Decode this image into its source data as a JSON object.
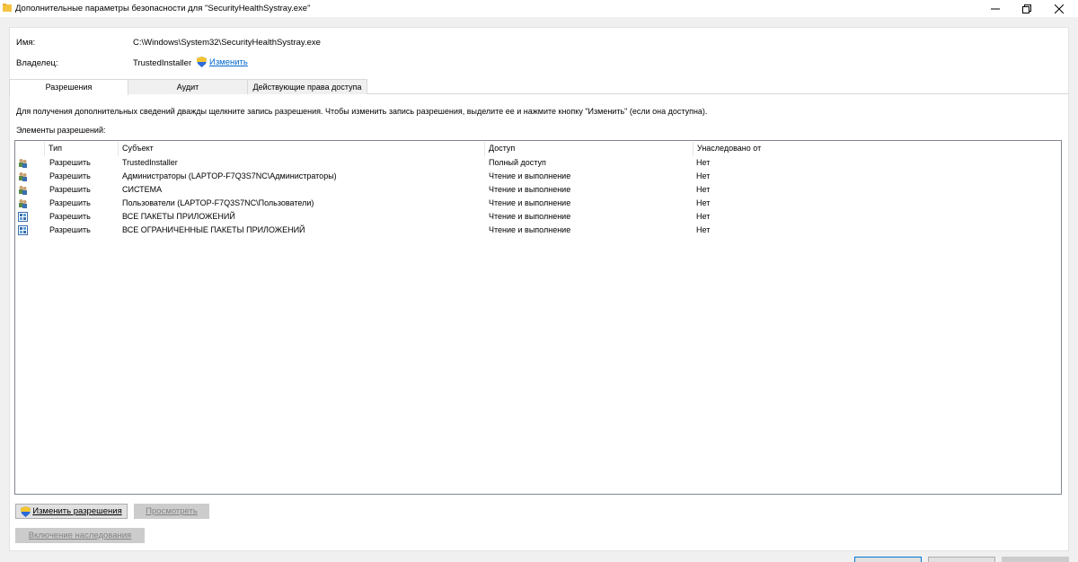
{
  "window": {
    "title": "Дополнительные параметры безопасности  для \"SecurityHealthSystray.exe\"",
    "buttons": {
      "minimize": "—",
      "maximize": "▢",
      "close": "✕"
    }
  },
  "fields": {
    "name_label": "Имя:",
    "name_value": "C:\\Windows\\System32\\SecurityHealthSystray.exe",
    "owner_label": "Владелец:",
    "owner_value": "TrustedInstaller",
    "owner_change_link": "Изменить"
  },
  "tabs": [
    {
      "label": "Разрешения",
      "active": true
    },
    {
      "label": "Аудит",
      "active": false
    },
    {
      "label": "Действующие права доступа",
      "active": false
    }
  ],
  "info_text": "Для получения дополнительных сведений дважды щелкните запись разрешения. Чтобы изменить запись разрешения, выделите ее и нажмите кнопку \"Изменить\" (если она доступна).",
  "elements_label": "Элементы разрешений:",
  "table": {
    "columns": [
      "Тип",
      "Субъект",
      "Доступ",
      "Унаследовано от"
    ],
    "rows": [
      {
        "icon": "users-icon",
        "type": "Разрешить",
        "subject": "TrustedInstaller",
        "access": "Полный доступ",
        "inherited": "Нет"
      },
      {
        "icon": "users-icon",
        "type": "Разрешить",
        "subject": "Администраторы (LAPTOP-F7Q3S7NC\\Администраторы)",
        "access": "Чтение и выполнение",
        "inherited": "Нет"
      },
      {
        "icon": "users-icon",
        "type": "Разрешить",
        "subject": "СИСТЕМА",
        "access": "Чтение и выполнение",
        "inherited": "Нет"
      },
      {
        "icon": "users-icon",
        "type": "Разрешить",
        "subject": "Пользователи (LAPTOP-F7Q3S7NC\\Пользователи)",
        "access": "Чтение и выполнение",
        "inherited": "Нет"
      },
      {
        "icon": "app-packages-icon",
        "type": "Разрешить",
        "subject": "ВСЕ ПАКЕТЫ ПРИЛОЖЕНИЙ",
        "access": "Чтение и выполнение",
        "inherited": "Нет"
      },
      {
        "icon": "app-packages-icon",
        "type": "Разрешить",
        "subject": "ВСЕ ОГРАНИЧЕННЫЕ ПАКЕТЫ ПРИЛОЖЕНИЙ",
        "access": "Чтение и выполнение",
        "inherited": "Нет"
      }
    ]
  },
  "buttons": {
    "change_permissions": "Изменить разрешения",
    "view": "Просмотреть",
    "enable_inheritance": "Включение наследования"
  },
  "colors": {
    "link": "#0066cc",
    "disabled_text": "#838383"
  }
}
